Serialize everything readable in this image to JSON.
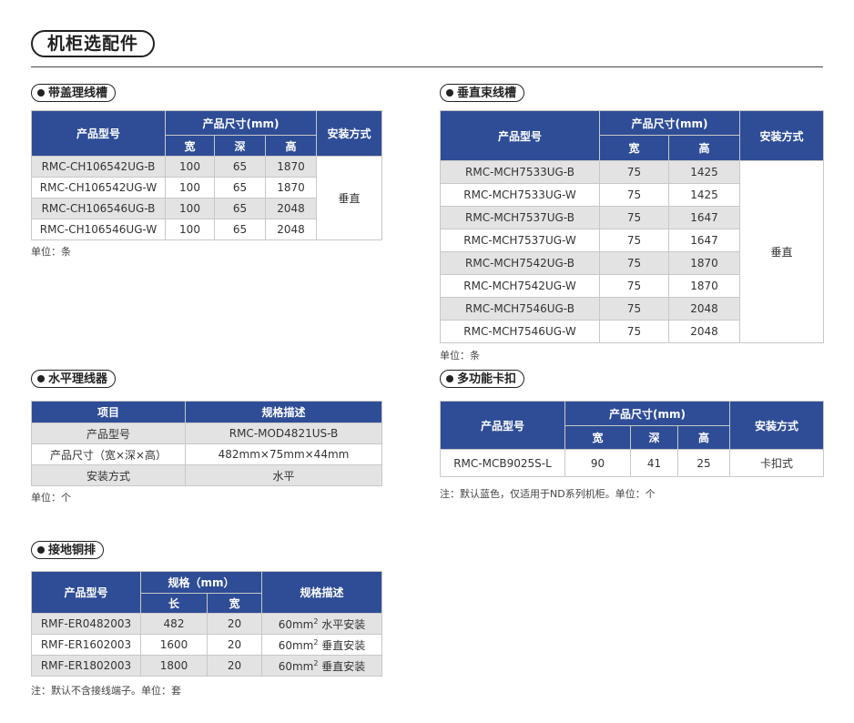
{
  "title": "机柜选配件",
  "cover_trunk": {
    "title": "带盖理线槽",
    "h_model": "产品型号",
    "h_size": "产品尺寸(mm)",
    "h_w": "宽",
    "h_d": "深",
    "h_h": "高",
    "h_install": "安装方式",
    "install": "垂直",
    "rows": [
      {
        "model": "RMC-CH106542UG-B",
        "w": "100",
        "d": "65",
        "h": "1870"
      },
      {
        "model": "RMC-CH106542UG-W",
        "w": "100",
        "d": "65",
        "h": "1870"
      },
      {
        "model": "RMC-CH106546UG-B",
        "w": "100",
        "d": "65",
        "h": "2048"
      },
      {
        "model": "RMC-CH106546UG-W",
        "w": "100",
        "d": "65",
        "h": "2048"
      }
    ],
    "note": "单位：条"
  },
  "vertical_trunk": {
    "title": "垂直束线槽",
    "h_model": "产品型号",
    "h_size": "产品尺寸(mm)",
    "h_w": "宽",
    "h_h": "高",
    "h_install": "安装方式",
    "install": "垂直",
    "rows": [
      {
        "model": "RMC-MCH7533UG-B",
        "w": "75",
        "h": "1425"
      },
      {
        "model": "RMC-MCH7533UG-W",
        "w": "75",
        "h": "1425"
      },
      {
        "model": "RMC-MCH7537UG-B",
        "w": "75",
        "h": "1647"
      },
      {
        "model": "RMC-MCH7537UG-W",
        "w": "75",
        "h": "1647"
      },
      {
        "model": "RMC-MCH7542UG-B",
        "w": "75",
        "h": "1870"
      },
      {
        "model": "RMC-MCH7542UG-W",
        "w": "75",
        "h": "1870"
      },
      {
        "model": "RMC-MCH7546UG-B",
        "w": "75",
        "h": "2048"
      },
      {
        "model": "RMC-MCH7546UG-W",
        "w": "75",
        "h": "2048"
      }
    ],
    "note": "单位：条"
  },
  "horizontal_manager": {
    "title": "水平理线器",
    "h_item": "项目",
    "h_spec": "规格描述",
    "rows": [
      {
        "item": "产品型号",
        "spec": "RMC-MOD4821US-B"
      },
      {
        "item": "产品尺寸（宽×深×高）",
        "spec": "482mm×75mm×44mm"
      },
      {
        "item": "安装方式",
        "spec": "水平"
      }
    ],
    "note": "单位：个"
  },
  "clip": {
    "title": "多功能卡扣",
    "h_model": "产品型号",
    "h_size": "产品尺寸(mm)",
    "h_w": "宽",
    "h_d": "深",
    "h_h": "高",
    "h_install": "安装方式",
    "row": {
      "model": "RMC-MCB9025S-L",
      "w": "90",
      "d": "41",
      "h": "25",
      "install": "卡扣式"
    },
    "note": "注：默认蓝色，仅适用于ND系列机柜。单位：个"
  },
  "ground_bar": {
    "title": "接地铜排",
    "h_model": "产品型号",
    "h_spec": "规格（mm）",
    "h_l": "长",
    "h_w": "宽",
    "h_desc": "规格描述",
    "rows": [
      {
        "model": "RMF-ER0482003",
        "l": "482",
        "w": "20",
        "area": "60mm",
        "sup": "2",
        "desc": "水平安装"
      },
      {
        "model": "RMF-ER1602003",
        "l": "1600",
        "w": "20",
        "area": "60mm",
        "sup": "2",
        "desc": "垂直安装"
      },
      {
        "model": "RMF-ER1802003",
        "l": "1800",
        "w": "20",
        "area": "60mm",
        "sup": "2",
        "desc": "垂直安装"
      }
    ],
    "note": "注：默认不含接线端子。单位：套"
  }
}
